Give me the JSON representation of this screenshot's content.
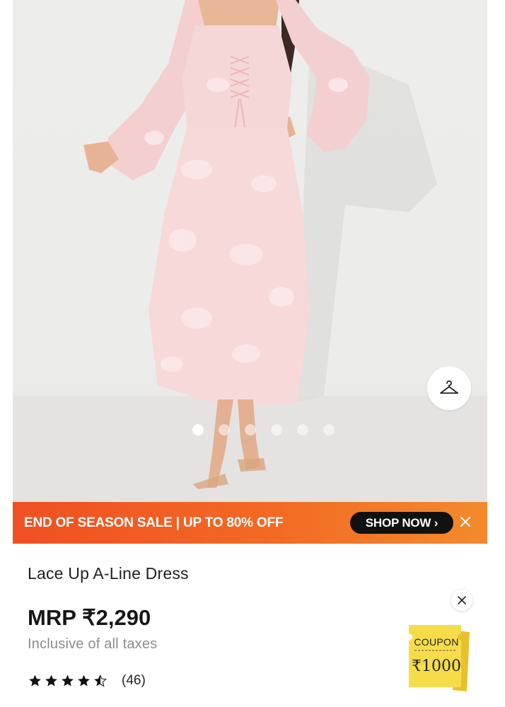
{
  "product_image": {
    "alt": "Lace Up A-Line Dress",
    "carousel_dot_count": 6,
    "active_dot_index": 0
  },
  "icons": {
    "wishlist": "hanger-icon",
    "banner_close": "close-icon",
    "coupon_close": "close-icon",
    "star": "star-icon"
  },
  "banner": {
    "text": "END OF SEASON SALE | UP TO 80% OFF",
    "cta": "SHOP NOW ›",
    "colors": {
      "start": "#f04f23",
      "end": "#f38a2c",
      "cta_bg": "#111111"
    }
  },
  "product": {
    "title": "Lace Up A-Line Dress",
    "price": "MRP ₹2,290",
    "tax_note": "Inclusive of all taxes",
    "rating": 4.5,
    "rating_count": "(46)"
  },
  "coupon": {
    "label": "COUPON",
    "amount": "₹1000",
    "color": "#f7dc4a"
  }
}
